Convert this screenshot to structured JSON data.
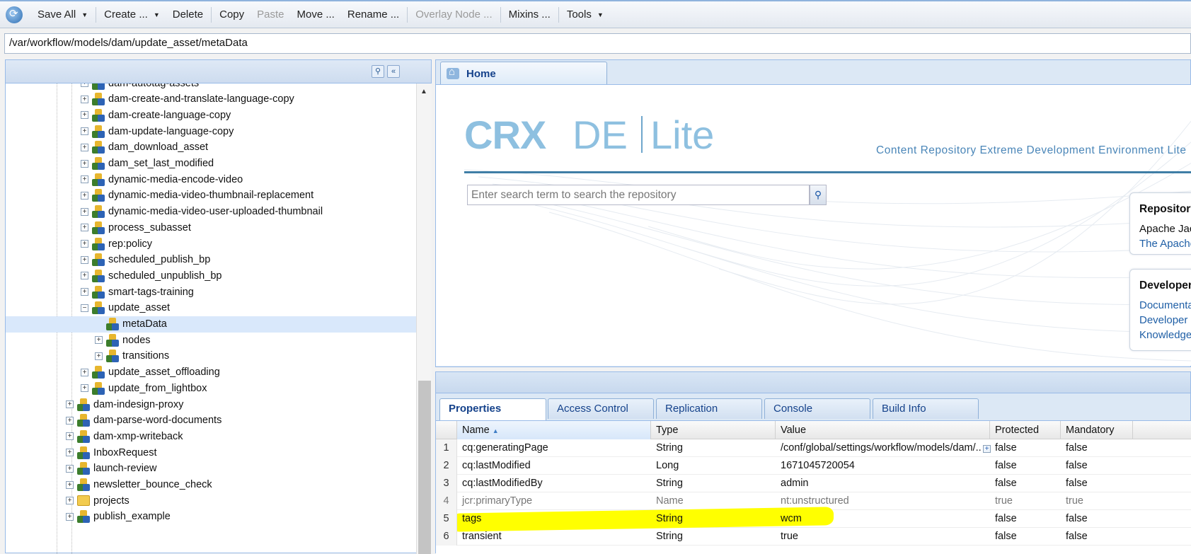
{
  "toolbar": {
    "save_all": "Save All",
    "create": "Create ...",
    "delete": "Delete",
    "copy": "Copy",
    "paste": "Paste",
    "move": "Move ...",
    "rename": "Rename ...",
    "overlay_node": "Overlay Node ...",
    "mixins": "Mixins ...",
    "tools": "Tools"
  },
  "path": "/var/workflow/models/dam/update_asset/metaData",
  "tree": [
    {
      "label": "dam-autotag-assets",
      "level": 2,
      "icon": "node-icon",
      "expander": "+"
    },
    {
      "label": "dam-create-and-translate-language-copy",
      "level": 2,
      "icon": "node-icon",
      "expander": "+"
    },
    {
      "label": "dam-create-language-copy",
      "level": 2,
      "icon": "node-icon",
      "expander": "+"
    },
    {
      "label": "dam-update-language-copy",
      "level": 2,
      "icon": "node-icon",
      "expander": "+"
    },
    {
      "label": "dam_download_asset",
      "level": 2,
      "icon": "node-icon",
      "expander": "+"
    },
    {
      "label": "dam_set_last_modified",
      "level": 2,
      "icon": "node-icon",
      "expander": "+"
    },
    {
      "label": "dynamic-media-encode-video",
      "level": 2,
      "icon": "node-icon",
      "expander": "+"
    },
    {
      "label": "dynamic-media-video-thumbnail-replacement",
      "level": 2,
      "icon": "node-icon",
      "expander": "+"
    },
    {
      "label": "dynamic-media-video-user-uploaded-thumbnail",
      "level": 2,
      "icon": "node-icon",
      "expander": "+"
    },
    {
      "label": "process_subasset",
      "level": 2,
      "icon": "node-icon",
      "expander": "+"
    },
    {
      "label": "rep:policy",
      "level": 2,
      "icon": "node-icon",
      "expander": "+"
    },
    {
      "label": "scheduled_publish_bp",
      "level": 2,
      "icon": "node-icon",
      "expander": "+"
    },
    {
      "label": "scheduled_unpublish_bp",
      "level": 2,
      "icon": "node-icon",
      "expander": "+"
    },
    {
      "label": "smart-tags-training",
      "level": 2,
      "icon": "node-icon",
      "expander": "+"
    },
    {
      "label": "update_asset",
      "level": 2,
      "icon": "node-icon",
      "expander": "−"
    },
    {
      "label": "metaData",
      "level": 3,
      "icon": "node-icon",
      "expander": "",
      "selected": true
    },
    {
      "label": "nodes",
      "level": 3,
      "icon": "node-icon",
      "expander": "+"
    },
    {
      "label": "transitions",
      "level": 3,
      "icon": "node-icon",
      "expander": "+"
    },
    {
      "label": "update_asset_offloading",
      "level": 2,
      "icon": "node-icon",
      "expander": "+"
    },
    {
      "label": "update_from_lightbox",
      "level": 2,
      "icon": "node-icon",
      "expander": "+"
    },
    {
      "label": "dam-indesign-proxy",
      "level": 1,
      "icon": "node-icon",
      "expander": "+"
    },
    {
      "label": "dam-parse-word-documents",
      "level": 1,
      "icon": "node-icon",
      "expander": "+"
    },
    {
      "label": "dam-xmp-writeback",
      "level": 1,
      "icon": "node-icon",
      "expander": "+"
    },
    {
      "label": "InboxRequest",
      "level": 1,
      "icon": "node-icon",
      "expander": "+"
    },
    {
      "label": "launch-review",
      "level": 1,
      "icon": "node-icon",
      "expander": "+"
    },
    {
      "label": "newsletter_bounce_check",
      "level": 1,
      "icon": "node-icon",
      "expander": "+"
    },
    {
      "label": "projects",
      "level": 1,
      "icon": "folder-icon",
      "expander": "+"
    },
    {
      "label": "publish_example",
      "level": 1,
      "icon": "node-icon",
      "expander": "+"
    }
  ],
  "home": {
    "tab_label": "Home",
    "logo_crx": "CRX",
    "logo_de": "DE",
    "logo_lite": "Lite",
    "tagline": "Content Repository Extreme Development Environment Lite",
    "search_placeholder": "Enter search term to search the repository",
    "repository_card": {
      "title": "Repository",
      "lines": [
        "Apache Jackrabbit",
        "The Apache"
      ]
    },
    "developer_card": {
      "title": "Developer",
      "links": [
        "Documentation",
        "Developer",
        "Knowledge"
      ]
    }
  },
  "bottom_tabs": [
    "Properties",
    "Access Control",
    "Replication",
    "Console",
    "Build Info"
  ],
  "properties": {
    "columns": [
      "Name",
      "Type",
      "Value",
      "Protected",
      "Mandatory"
    ],
    "rows": [
      {
        "num": "1",
        "name": "cq:generatingPage",
        "type": "String",
        "value": "/conf/global/settings/workflow/models/dam/...",
        "protected": "false",
        "mandatory": "false"
      },
      {
        "num": "2",
        "name": "cq:lastModified",
        "type": "Long",
        "value": "1671045720054",
        "protected": "false",
        "mandatory": "false"
      },
      {
        "num": "3",
        "name": "cq:lastModifiedBy",
        "type": "String",
        "value": "admin",
        "protected": "false",
        "mandatory": "false"
      },
      {
        "num": "4",
        "name": "jcr:primaryType",
        "type": "Name",
        "value": "nt:unstructured",
        "protected": "true",
        "mandatory": "true"
      },
      {
        "num": "5",
        "name": "tags",
        "type": "String",
        "value": "wcm",
        "protected": "false",
        "mandatory": "false",
        "highlighted": true
      },
      {
        "num": "6",
        "name": "transient",
        "type": "String",
        "value": "true",
        "protected": "false",
        "mandatory": "false"
      }
    ]
  },
  "colors": {
    "accent": "#15428b",
    "panel_border": "#99bbe8",
    "highlight": "#ffff00",
    "logo": "#8ec0e0"
  }
}
